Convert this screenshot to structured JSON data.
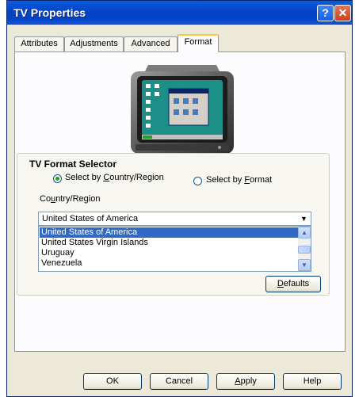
{
  "window": {
    "title": "TV Properties"
  },
  "tabs": [
    {
      "label": "Attributes"
    },
    {
      "label": "Adjustments"
    },
    {
      "label": "Advanced"
    },
    {
      "label": "Format",
      "active": true
    }
  ],
  "format_group": {
    "title": "TV Format Selector",
    "radio_country": {
      "label_pre": "Select by ",
      "label_mnemonic": "C",
      "label_post": "ountry/Region",
      "checked": true
    },
    "radio_format": {
      "label_pre": "Select by ",
      "label_mnemonic": "F",
      "label_post": "ormat",
      "checked": false
    },
    "country_label": {
      "pre": "Co",
      "mnemonic": "u",
      "post": "ntry/Region"
    },
    "country_combo": {
      "value": "United States of America",
      "options": [
        "United States of America",
        "United States Virgin Islands",
        "Uruguay",
        "Venezuela"
      ],
      "selected_index": 0
    },
    "defaults_button": {
      "mnemonic": "D",
      "rest": "efaults"
    }
  },
  "footer": {
    "ok": "OK",
    "cancel": "Cancel",
    "apply_mnemonic": "A",
    "apply_rest": "pply",
    "help": "Help"
  },
  "colors": {
    "title_bar": "#0346c9",
    "selection": "#316ac5",
    "window_bg": "#ece9d8"
  },
  "icons": [
    "help-icon",
    "close-icon",
    "chevron-down-icon",
    "chevron-up-icon",
    "tv-image"
  ]
}
